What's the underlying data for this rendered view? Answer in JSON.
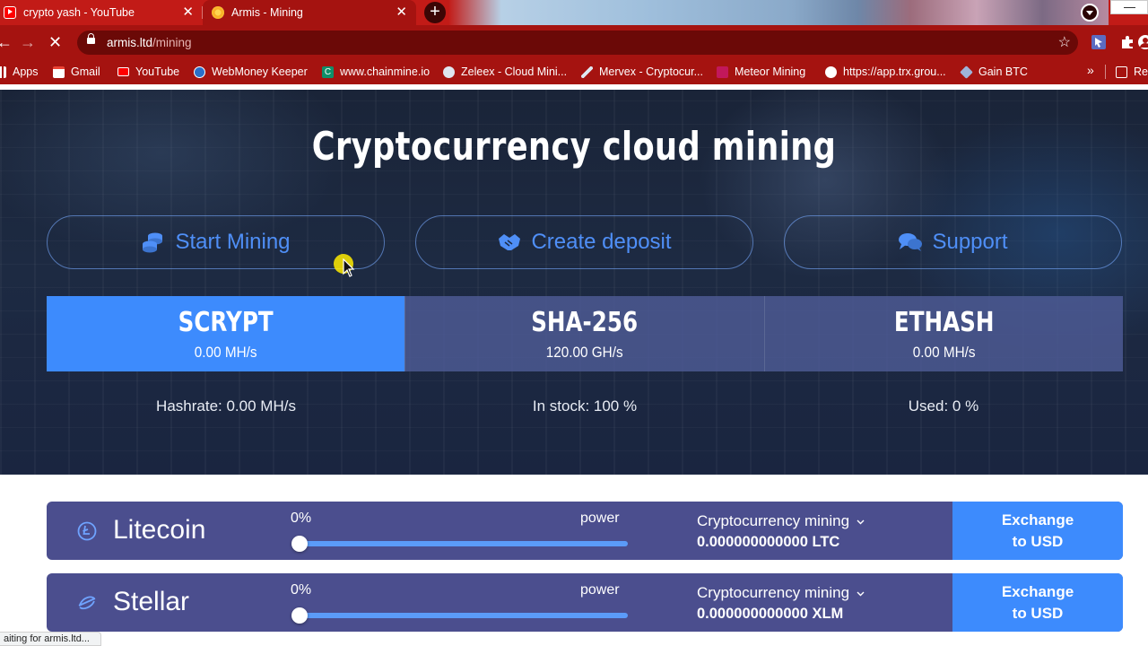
{
  "browser": {
    "tabs": [
      {
        "title": "crypto yash - YouTube",
        "icon": "youtube-icon",
        "active": false
      },
      {
        "title": "Armis - Mining",
        "icon": "armis-favicon",
        "active": true
      }
    ],
    "url_host": "armis.ltd",
    "url_path": "/mining",
    "bookmarks": [
      {
        "label": "Apps",
        "icon": "apps-icon"
      },
      {
        "label": "Gmail",
        "icon": "gmail-icon"
      },
      {
        "label": "YouTube",
        "icon": "youtube-icon"
      },
      {
        "label": "WebMoney Keeper",
        "icon": "webmoney-icon"
      },
      {
        "label": "www.chainmine.io",
        "icon": "chainmine-icon"
      },
      {
        "label": "Zeleex - Cloud Mini...",
        "icon": "zeleex-icon"
      },
      {
        "label": "Mervex - Cryptocur...",
        "icon": "mervex-icon"
      },
      {
        "label": "Meteor Mining",
        "icon": "meteor-icon"
      },
      {
        "label": "https://app.trx.grou...",
        "icon": "globe-icon"
      },
      {
        "label": "Gain BTC",
        "icon": "gainbtc-icon"
      }
    ],
    "bookmark_overflow": "»",
    "reading_list_label": "Re",
    "status_text": "aiting for armis.ltd..."
  },
  "hero": {
    "title": "Cryptocurrency cloud mining",
    "actions": [
      {
        "label": "Start Mining",
        "icon": "coins-icon"
      },
      {
        "label": "Create deposit",
        "icon": "handshake-icon"
      },
      {
        "label": "Support",
        "icon": "chat-icon"
      }
    ],
    "algorithms": [
      {
        "name": "SCRYPT",
        "rate": "0.00 MH/s",
        "active": true
      },
      {
        "name": "SHA-256",
        "rate": "120.00 GH/s",
        "active": false
      },
      {
        "name": "ETHASH",
        "rate": "0.00 MH/s",
        "active": false
      }
    ],
    "stats": [
      "Hashrate: 0.00 MH/s",
      "In stock: 100 %",
      "Used: 0 %"
    ]
  },
  "coins": [
    {
      "name": "Litecoin",
      "icon": "litecoin-icon",
      "percent": "0%",
      "power_label": "power",
      "power_value": 0,
      "mining_label": "Cryptocurrency mining",
      "mining_value": "0.000000000000 LTC",
      "exchange_label_1": "Exchange",
      "exchange_label_2": "to USD"
    },
    {
      "name": "Stellar",
      "icon": "stellar-icon",
      "percent": "0%",
      "power_label": "power",
      "power_value": 0,
      "mining_label": "Cryptocurrency mining",
      "mining_value": "0.000000000000 XLM",
      "exchange_label_1": "Exchange",
      "exchange_label_2": "to USD"
    }
  ],
  "colors": {
    "browser_red": "#c21b17",
    "accent_blue": "#3d8bfd",
    "row_bg": "#4b4e8e"
  }
}
